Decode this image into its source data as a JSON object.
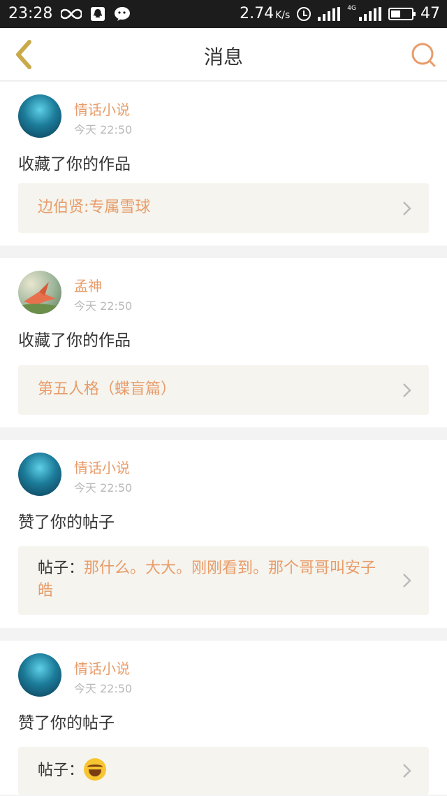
{
  "status_bar": {
    "time": "23:28",
    "left_icons": [
      "infinity-icon",
      "qq-icon",
      "wechat-icon"
    ],
    "net_speed": "2.74",
    "net_speed_unit": "K/s",
    "network_type": "4G",
    "battery_level": "47",
    "battery_fraction": 0.47
  },
  "header": {
    "title": "消息",
    "back_icon": "chevron-left-icon",
    "search_icon": "search-icon"
  },
  "colors": {
    "accent": "#e89c6a",
    "back": "#c9a94a",
    "content_bg": "#f5f4ee"
  },
  "messages": [
    {
      "username": "情话小说",
      "time": "今天 22:50",
      "action": "收藏了你的作品",
      "content": "边伯贤:专属雪球"
    },
    {
      "username": "孟神",
      "time": "今天 22:50",
      "action": "收藏了你的作品",
      "content": "第五人格（蝶盲篇）"
    },
    {
      "username": "情话小说",
      "time": "今天 22:50",
      "action": "赞了你的帖子",
      "content_prefix": "帖子：",
      "content": "那什么。大大。刚刚看到。那个哥哥叫安子皓"
    },
    {
      "username": "情话小说",
      "time": "今天 22:50",
      "action": "赞了你的帖子",
      "content_prefix": "帖子：",
      "content_emoji": "tears-of-joy-emoji-icon"
    }
  ]
}
